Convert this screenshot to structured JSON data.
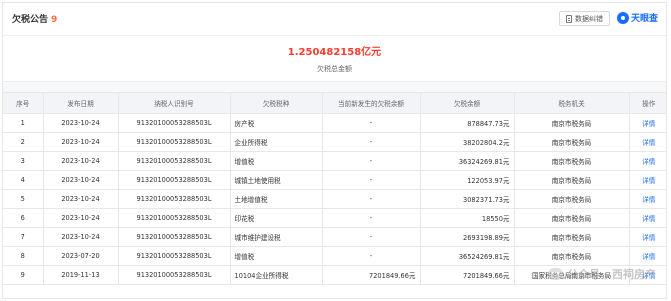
{
  "header": {
    "title": "欠税公告",
    "count": "9",
    "download_label": "数据纠错",
    "brand_name": "天眼查"
  },
  "summary": {
    "amount": "1.250482158亿元",
    "label": "欠税总金额"
  },
  "table": {
    "columns": [
      "序号",
      "发布日期",
      "纳税人识别号",
      "欠税税种",
      "当前新发生的欠税余额",
      "欠税余额",
      "税务机关",
      "操作"
    ],
    "rows": [
      {
        "no": "1",
        "date": "2023-10-24",
        "tax_id": "91320100053288503L",
        "type": "房产税",
        "new_balance": "-",
        "balance": "878847.73元",
        "authority": "南京市税务局",
        "action": "详情"
      },
      {
        "no": "2",
        "date": "2023-10-24",
        "tax_id": "91320100053288503L",
        "type": "企业所得税",
        "new_balance": "-",
        "balance": "38202804.2元",
        "authority": "南京市税务局",
        "action": "详情"
      },
      {
        "no": "3",
        "date": "2023-10-24",
        "tax_id": "91320100053288503L",
        "type": "增值税",
        "new_balance": "-",
        "balance": "36324269.81元",
        "authority": "南京市税务局",
        "action": "详情"
      },
      {
        "no": "4",
        "date": "2023-10-24",
        "tax_id": "91320100053288503L",
        "type": "城镇土地使用税",
        "new_balance": "-",
        "balance": "122053.97元",
        "authority": "南京市税务局",
        "action": "详情"
      },
      {
        "no": "5",
        "date": "2023-10-24",
        "tax_id": "91320100053288503L",
        "type": "土地增值税",
        "new_balance": "-",
        "balance": "3082371.73元",
        "authority": "南京市税务局",
        "action": "详情"
      },
      {
        "no": "6",
        "date": "2023-10-24",
        "tax_id": "91320100053288503L",
        "type": "印花税",
        "new_balance": "-",
        "balance": "18550元",
        "authority": "南京市税务局",
        "action": "详情"
      },
      {
        "no": "7",
        "date": "2023-10-24",
        "tax_id": "91320100053288503L",
        "type": "城市维护建设税",
        "new_balance": "-",
        "balance": "2693198.89元",
        "authority": "南京市税务局",
        "action": "详情"
      },
      {
        "no": "8",
        "date": "2023-07-20",
        "tax_id": "91320100053288503L",
        "type": "增值税",
        "new_balance": "-",
        "balance": "36524269.81元",
        "authority": "南京市税务局",
        "action": "详情"
      },
      {
        "no": "9",
        "date": "2019-11-13",
        "tax_id": "91320100053288503L",
        "type": "10104企业所得税",
        "new_balance": "7201849.66元",
        "balance": "7201849.66元",
        "authority": "国家税务总局南京市税务局",
        "action": "详情"
      }
    ]
  },
  "watermark": {
    "text": "公众号 · 西祠房产",
    "icon": "wechat-icon"
  }
}
